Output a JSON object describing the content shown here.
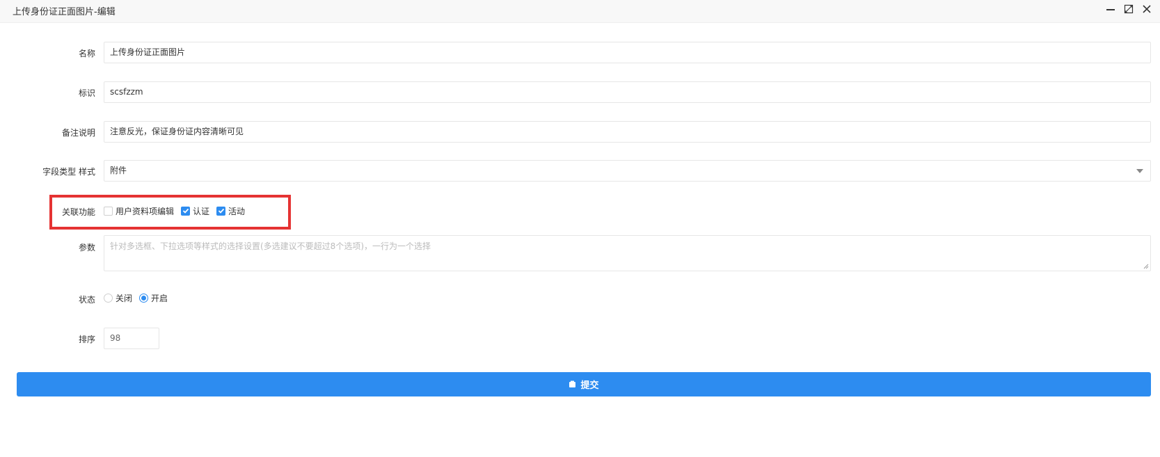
{
  "window": {
    "title": "上传身份证正面图片-编辑"
  },
  "form": {
    "name": {
      "label": "名称",
      "value": "上传身份证正面图片"
    },
    "identifier": {
      "label": "标识",
      "value": "scsfzzm"
    },
    "remark": {
      "label": "备注说明",
      "value": "注意反光，保证身份证内容清晰可见"
    },
    "field_type": {
      "label": "字段类型 样式",
      "value": "附件"
    },
    "related": {
      "label": "关联功能",
      "options": [
        {
          "label": "用户资料项编辑",
          "checked": false
        },
        {
          "label": "认证",
          "checked": true
        },
        {
          "label": "活动",
          "checked": true
        }
      ]
    },
    "params": {
      "label": "参数",
      "placeholder": "针对多选框、下拉选项等样式的选择设置(多选建议不要超过8个选项)，一行为一个选择"
    },
    "status": {
      "label": "状态",
      "options": [
        {
          "label": "关闭",
          "selected": false
        },
        {
          "label": "开启",
          "selected": true
        }
      ]
    },
    "sort": {
      "label": "排序",
      "value": "98"
    },
    "submit_label": "提交"
  },
  "colors": {
    "accent": "#2d8cf0",
    "highlight": "#e53333"
  }
}
